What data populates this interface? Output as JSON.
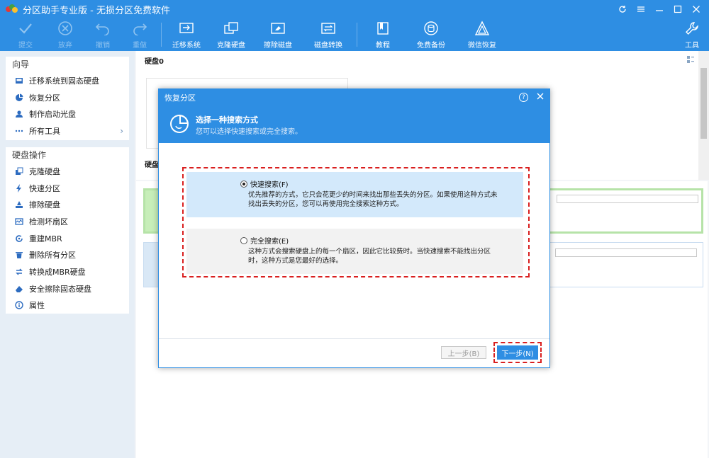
{
  "app": {
    "title": "分区助手专业版 - 无损分区免费软件",
    "accent_color": "#2e8ee3"
  },
  "window_controls": {
    "refresh_icon": "refresh-icon",
    "menu_icon": "menu-icon",
    "minimize_icon": "minimize-icon",
    "maximize_icon": "maximize-icon",
    "close_icon": "close-icon"
  },
  "toolbar": {
    "commit": "提交",
    "discard": "放弃",
    "undo": "撤销",
    "redo": "重做",
    "migrate_os": "迁移系统",
    "clone_disk": "克隆硬盘",
    "wipe_disk": "擦除磁盘",
    "disk_convert": "磁盘转换",
    "tutorial": "教程",
    "free_backup": "免费备份",
    "wechat_recovery": "微信恢复",
    "tools": "工具"
  },
  "sidebar": {
    "wizard": {
      "title": "向导",
      "items": [
        {
          "label": "迁移系统到固态硬盘",
          "icon": "migrate-icon"
        },
        {
          "label": "恢复分区",
          "icon": "pie-icon"
        },
        {
          "label": "制作启动光盘",
          "icon": "user-icon"
        },
        {
          "label": "所有工具",
          "icon": "more-icon"
        }
      ]
    },
    "disk_ops": {
      "title": "硬盘操作",
      "items": [
        {
          "label": "克隆硬盘",
          "icon": "clone-icon"
        },
        {
          "label": "快速分区",
          "icon": "lightning-icon"
        },
        {
          "label": "擦除硬盘",
          "icon": "eraser-icon"
        },
        {
          "label": "检测坏扇区",
          "icon": "scan-icon"
        },
        {
          "label": "重建MBR",
          "icon": "rebuild-icon"
        },
        {
          "label": "删除所有分区",
          "icon": "trash-icon"
        },
        {
          "label": "转换成MBR硬盘",
          "icon": "convert-icon"
        },
        {
          "label": "安全擦除固态硬盘",
          "icon": "secure-erase-icon"
        },
        {
          "label": "属性",
          "icon": "info-icon"
        }
      ]
    }
  },
  "main": {
    "disk0_label": "硬盘0",
    "disk1_label": "硬盘"
  },
  "dialog": {
    "title": "恢复分区",
    "header_title": "选择一种搜索方式",
    "header_subtitle": "您可以选择快速搜索或完全搜索。",
    "options": [
      {
        "label": "快速搜索(F)",
        "description": "优先推荐的方式，它只会花更少的时间来找出那些丢失的分区。如果使用这种方式未找出丢失的分区，您可以再使用完全搜索这种方式。",
        "selected": true
      },
      {
        "label": "完全搜索(E)",
        "description": "这种方式会搜索硬盘上的每一个扇区，因此它比较费时。当快速搜索不能找出分区时，这种方式是您最好的选择。",
        "selected": false
      }
    ],
    "prev_button": "上一步(B)",
    "next_button": "下一步(N)"
  }
}
